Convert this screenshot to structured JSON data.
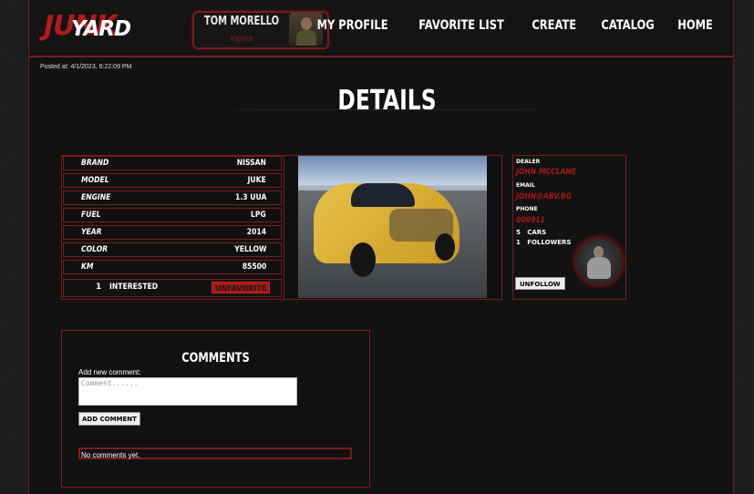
{
  "brand": {
    "logo_part1": "JUNK",
    "logo_part2": "YARD"
  },
  "user": {
    "name": "TOM MORELLO",
    "logout_label": "logout"
  },
  "nav": [
    "MY PROFILE",
    "FAVORITE LIST",
    "CREATE",
    "CATALOG",
    "HOME"
  ],
  "posted": "Posted at: 4/1/2023, 6:22:09 PM",
  "page_title": "DETAILS",
  "specs": [
    {
      "label": "BRAND",
      "value": "NISSAN"
    },
    {
      "label": "MODEL",
      "value": "JUKE"
    },
    {
      "label": "ENGINE",
      "value": "1.3 UUA"
    },
    {
      "label": "FUEL",
      "value": "LPG"
    },
    {
      "label": "YEAR",
      "value": "2014"
    },
    {
      "label": "COLOR",
      "value": "YELLOW"
    },
    {
      "label": "KM",
      "value": "85500"
    }
  ],
  "interested": {
    "count": "1",
    "label": "INTERESTED",
    "unfavorite_label": "UNFAVORITE"
  },
  "dealer": {
    "dealer_label": "DEALER",
    "dealer_name": "JOHN MCCLANE",
    "email_label": "EMAIL",
    "email": "JOHN@ABV.BG",
    "phone_label": "PHONE",
    "phone": "000911",
    "cars_count": "5",
    "cars_label": "CARS",
    "followers_count": "1",
    "followers_label": "FOLLOWERS",
    "unfollow_label": "UNFOLLOW"
  },
  "comments": {
    "heading": "COMMENTS",
    "add_label": "Add new comment:",
    "placeholder": "Comment......",
    "add_button": "ADD COMMENT",
    "empty_text": "No comments yet."
  },
  "colors": {
    "accent": "#a51717",
    "border": "#7a1c1c",
    "background": "#121212"
  }
}
